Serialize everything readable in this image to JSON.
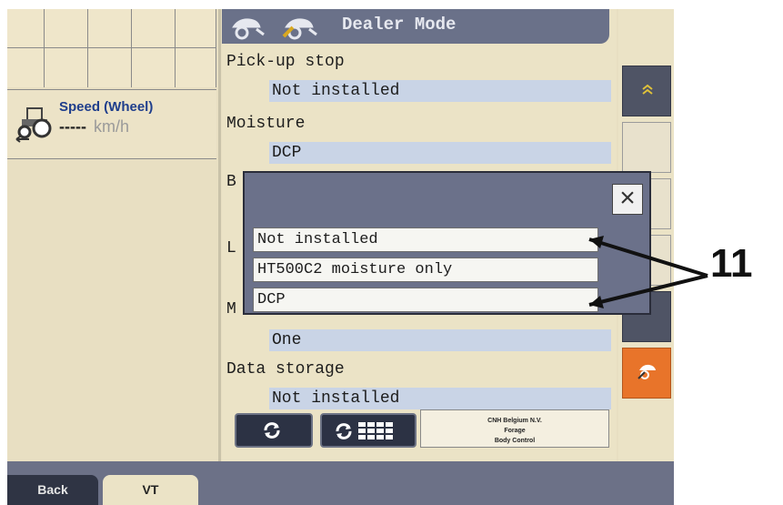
{
  "colors": {
    "accent": "#e8742a",
    "title_bar": "#6a7189",
    "value_highlight": "#c9d4e6",
    "background": "#e8dfc2"
  },
  "speed": {
    "label": "Speed (Wheel)",
    "value": "-----",
    "unit": "km/h",
    "icon": "tractor-icon"
  },
  "header": {
    "title": "Dealer Mode",
    "icons": [
      "baler-icon",
      "baler-settings-icon"
    ]
  },
  "params": [
    {
      "label": "Pick-up stop",
      "value": "Not installed"
    },
    {
      "label": "Moisture",
      "value": "DCP"
    },
    {
      "label": "B",
      "value": ""
    },
    {
      "label": "L",
      "value": ""
    },
    {
      "label": "M",
      "value": "One"
    },
    {
      "label": "Data storage",
      "value": "Not installed"
    }
  ],
  "bottom_buttons": [
    {
      "name": "refresh-button",
      "icon": "refresh-icon"
    },
    {
      "name": "refresh-grid-button",
      "icon": "refresh-grid-icon"
    }
  ],
  "manufacturer": {
    "line1": "CNH Belgium N.V.",
    "line2": "Forage",
    "line3": "Body Control"
  },
  "softkeys": [
    {
      "icon": "double-chevron-up-icon",
      "style": "dark"
    },
    {
      "icon": "",
      "style": "light"
    },
    {
      "icon": "",
      "style": "light"
    },
    {
      "icon": "",
      "style": "light"
    },
    {
      "icon": "",
      "style": "dark"
    },
    {
      "icon": "baler-settings-icon",
      "style": "orange"
    }
  ],
  "footer": {
    "tabs": [
      {
        "label": "Back",
        "active": false
      },
      {
        "label": "VT",
        "active": true
      }
    ]
  },
  "popup": {
    "close_label": "×",
    "options": [
      "Not installed",
      "HT500C2 moisture only",
      "DCP"
    ]
  },
  "callout": {
    "label": "11"
  }
}
